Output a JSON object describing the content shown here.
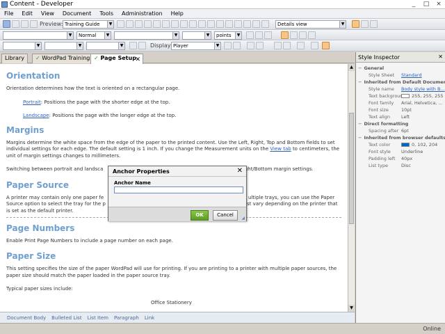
{
  "window": {
    "title": "Content - Developer",
    "buttons": [
      "_",
      "□",
      "×"
    ]
  },
  "menu": [
    "File",
    "Edit",
    "View",
    "Document",
    "Tools",
    "Administration",
    "Help"
  ],
  "toolbar1": {
    "preview_label": "Preview:",
    "preview_value": "Training Guide",
    "view_value": "Details view"
  },
  "toolbar2": {
    "style_value": "Normal",
    "unit_value": "points"
  },
  "toolbar3": {
    "display_label": "Display:",
    "display_value": "Player"
  },
  "tabs": [
    {
      "label": "Library"
    },
    {
      "label": "WordPad Training"
    },
    {
      "label": "Page Setup"
    }
  ],
  "document": {
    "orientation_title": "Orientation",
    "orientation_text": "Orientation determines how the text is oriented on a rectangular page.",
    "portrait_link": "Portrait",
    "portrait_text": ": Positions the page with the shorter edge at the top.",
    "landscape_link": "Landscape",
    "landscape_text": ": Positions the page with the longer edge at the top.",
    "margins_title": "Margins",
    "margins_text_a": "Margins determine the white space from the edge of the paper to the printed content. Use the Left, Right, Top and Bottom fields to set individual settings for each edge. The default setting is 1 inch. If you change the Measurement units on the",
    "margins_link": "View tab",
    "margins_text_b": "to centimeters, the unit of margin settings changes to millimeters.",
    "switching_text": "Switching between portrait and landsca",
    "switching_text_end": "Right/Bottom margin settings.",
    "paper_source_title": "Paper Source",
    "paper_source_text_a": "A printer may contain only one paper fe",
    "paper_source_text_b": "ultiple trays, you can use the Paper",
    "paper_source_text_c": "Source option to select the tray for the p",
    "paper_source_text_d": "st vary depending on the printer that",
    "paper_source_text_e": "is set as the default printer.",
    "page_numbers_title": "Page Numbers",
    "page_numbers_text": "Enable Print Page Numbers to include a page number on each page.",
    "paper_size_title": "Paper Size",
    "paper_size_text": "This setting specifies the size of the paper WordPad will use for printing. If you are printing to a printer with multiple paper sources, the paper size should match the paper loaded in the paper source tray.",
    "typical_text": "Typical paper sizes include:",
    "cut_text": "Office Stationery"
  },
  "statusbar": [
    "Document Body",
    "Bulleted List",
    "List Item",
    "Paragraph",
    "Link"
  ],
  "inspector": {
    "title": "Style Inspector",
    "sections": [
      {
        "name": "General",
        "rows": [
          {
            "key": "Style Sheet",
            "value": "Standard",
            "link": true
          }
        ]
      },
      {
        "name": "Inherited from Default Document",
        "rows": [
          {
            "key": "Style name",
            "value": "Body style with B...",
            "link": true
          },
          {
            "key": "Text backgrour",
            "value": "255, 255, 255",
            "swatch": "#ffffff"
          },
          {
            "key": "Font family",
            "value": "Arial, Helvetica, ..."
          },
          {
            "key": "Font size",
            "value": "10pt"
          },
          {
            "key": "Text align",
            "value": "Left"
          }
        ]
      },
      {
        "name": "Direct formatting",
        "rows": [
          {
            "key": "Spacing after",
            "value": "6pt"
          }
        ]
      },
      {
        "name": "Inherited from browser defaults",
        "rows": [
          {
            "key": "Text color",
            "value": "0, 102, 204",
            "swatch": "#0066cc"
          },
          {
            "key": "Font style",
            "value": "Underline"
          },
          {
            "key": "Padding left",
            "value": "40px"
          },
          {
            "key": "List type",
            "value": "Disc"
          }
        ]
      }
    ]
  },
  "dialog": {
    "title": "Anchor Properties",
    "label": "Anchor Name",
    "input_value": "",
    "ok": "OK",
    "cancel": "Cancel"
  },
  "bottom": {
    "status": "Online"
  },
  "colors": {
    "heading": "#6f9fd0",
    "link": "#2b5fb8",
    "ok_button": "#5a9c22"
  }
}
